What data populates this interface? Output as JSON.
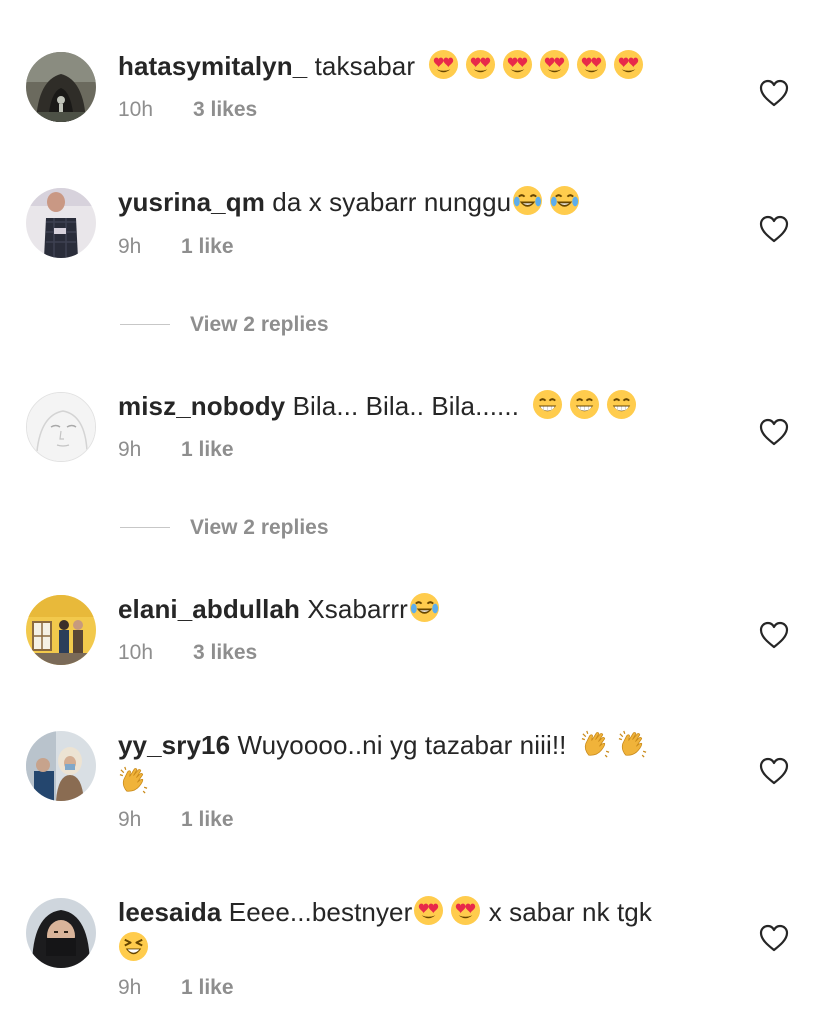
{
  "comments": [
    {
      "username": "hatasymitalyn_",
      "text": "taksabar",
      "emojis": [
        "heart-eyes",
        "heart-eyes",
        "heart-eyes",
        "heart-eyes",
        "heart-eyes",
        "heart-eyes"
      ],
      "time": "10h",
      "likes": "3 likes"
    },
    {
      "username": "yusrina_qm",
      "text": "da x syabarr nunggu",
      "emojis": [
        "tears-of-joy",
        "tears-of-joy"
      ],
      "time": "9h",
      "likes": "1 like"
    },
    {
      "username": "misz_nobody",
      "text": "Bila... Bila.. Bila......",
      "emojis": [
        "beaming-face",
        "beaming-face",
        "beaming-face"
      ],
      "time": "9h",
      "likes": "1 like"
    },
    {
      "username": "elani_abdullah",
      "text": "Xsabarrr",
      "emojis": [
        "tears-of-joy"
      ],
      "time": "10h",
      "likes": "3 likes"
    },
    {
      "username": "yy_sry16",
      "text": "Wuyoooo..ni yg tazabar niii!!",
      "emojis": [
        "clapping-hands",
        "clapping-hands",
        "clapping-hands"
      ],
      "time": "9h",
      "likes": "1 like"
    },
    {
      "username": "leesaida",
      "text": "Eeee...bestnyer",
      "emojis": [
        "heart-eyes",
        "heart-eyes"
      ],
      "text2": "x sabar nk tgk",
      "emojis2": [
        "squinting-face"
      ],
      "time": "9h",
      "likes": "1 like"
    }
  ],
  "replies": [
    {
      "label": "View 2 replies"
    },
    {
      "label": "View 2 replies"
    }
  ],
  "colors": {
    "text": "#262626",
    "muted": "#8e8e8e",
    "divider": "#c7c7c7",
    "emoji_yellow": "#ffcc4d",
    "emoji_heart": "#e8294a"
  },
  "icons": {
    "like": "heart-outline-icon"
  }
}
